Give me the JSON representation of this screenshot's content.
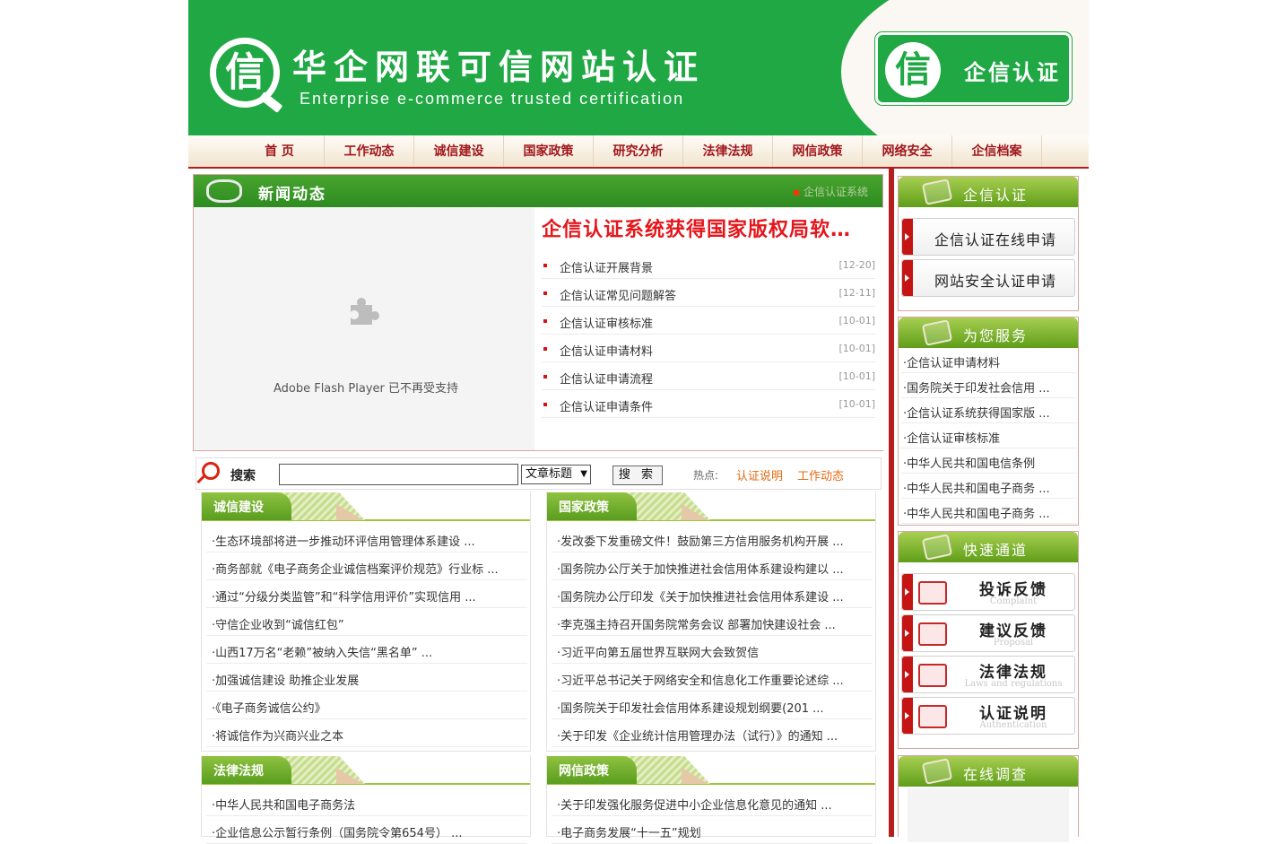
{
  "header": {
    "logo_char": "信",
    "title": "华企网联可信网站认证",
    "subtitle": "Enterprise e-commerce trusted certification",
    "badge_char": "信",
    "badge_text": "企信认证"
  },
  "nav": [
    "首 页",
    "工作动态",
    "诚信建设",
    "国家政策",
    "研究分析",
    "法律法规",
    "网信政策",
    "网络安全",
    "企信档案"
  ],
  "news": {
    "head_title": "新闻动态",
    "marquee": "企信认证系统",
    "flash_message": "Adobe Flash Player 已不再受支持",
    "headline": "企信认证系统获得国家版权局软…",
    "items": [
      {
        "title": "企信认证开展背景",
        "date": "[12-20]"
      },
      {
        "title": "企信认证常见问题解答",
        "date": "[12-11]"
      },
      {
        "title": "企信认证审核标准",
        "date": "[10-01]"
      },
      {
        "title": "企信认证申请材料",
        "date": "[10-01]"
      },
      {
        "title": "企信认证申请流程",
        "date": "[10-01]"
      },
      {
        "title": "企信认证申请条件",
        "date": "[10-01]"
      }
    ]
  },
  "search": {
    "label": "搜索",
    "input_value": "",
    "select_value": "文章标题",
    "button": "搜 索",
    "hot_label": "热点:",
    "hot_links": [
      "认证说明",
      "工作动态"
    ]
  },
  "categories": {
    "chengxin": {
      "title": "诚信建设",
      "items": [
        "·生态环境部将进一步推动环评信用管理体系建设 ...",
        "·商务部就《电子商务企业诚信档案评价规范》行业标 ...",
        "·通过“分级分类监管”和“科学信用评价”实现信用 ...",
        "·守信企业收到“诚信红包”",
        "·山西17万名“老赖”被纳入失信“黑名单” ...",
        "·加强诚信建设 助推企业发展",
        "·《电子商务诚信公约》",
        "·将诚信作为兴商兴业之本"
      ]
    },
    "guojia": {
      "title": "国家政策",
      "items": [
        "·发改委下发重磅文件！鼓励第三方信用服务机构开展 ...",
        "·国务院办公厅关于加快推进社会信用体系建设构建以 ...",
        "·国务院办公厅印发《关于加快推进社会信用体系建设 ...",
        "·李克强主持召开国务院常务会议 部署加快建设社会 ...",
        "·习近平向第五届世界互联网大会致贺信",
        "·习近平总书记关于网络安全和信息化工作重要论述综 ...",
        "·国务院关于印发社会信用体系建设规划纲要(201 ...",
        "·关于印发《企业统计信用管理办法（试行）》的通知 ..."
      ]
    },
    "falv": {
      "title": "法律法规",
      "items": [
        "·中华人民共和国电子商务法",
        "·企业信息公示暂行条例（国务院令第654号） ..."
      ]
    },
    "wangxin": {
      "title": "网信政策",
      "items": [
        "·关于印发强化服务促进中小企业信息化意见的通知 ...",
        "·电子商务发展“十一五”规划"
      ]
    }
  },
  "sidebar": {
    "cert": {
      "title": "企信认证",
      "buttons": [
        "企信认证在线申请",
        "网站安全认证申请"
      ]
    },
    "service": {
      "title": "为您服务",
      "items": [
        "·企信认证申请材料",
        "·国务院关于印发社会信用 ...",
        "·企信认证系统获得国家版 ...",
        "·企信认证审核标准",
        "·中华人民共和国电信条例",
        "·中华人民共和国电子商务 ...",
        "·中华人民共和国电子商务 ..."
      ]
    },
    "quick": {
      "title": "快速通道",
      "buttons": [
        {
          "title": "投诉反馈",
          "sub": "Complaint"
        },
        {
          "title": "建议反馈",
          "sub": "Proposal"
        },
        {
          "title": "法律法规",
          "sub": "Laws and regulations"
        },
        {
          "title": "认证说明",
          "sub": "Authentication"
        }
      ]
    },
    "survey": {
      "title": "在线调查"
    }
  },
  "colors": {
    "brand_green": "#1fa844",
    "nav_red": "#a0171b",
    "headline_red": "#e4161b",
    "hot_orange": "#e26a12"
  }
}
